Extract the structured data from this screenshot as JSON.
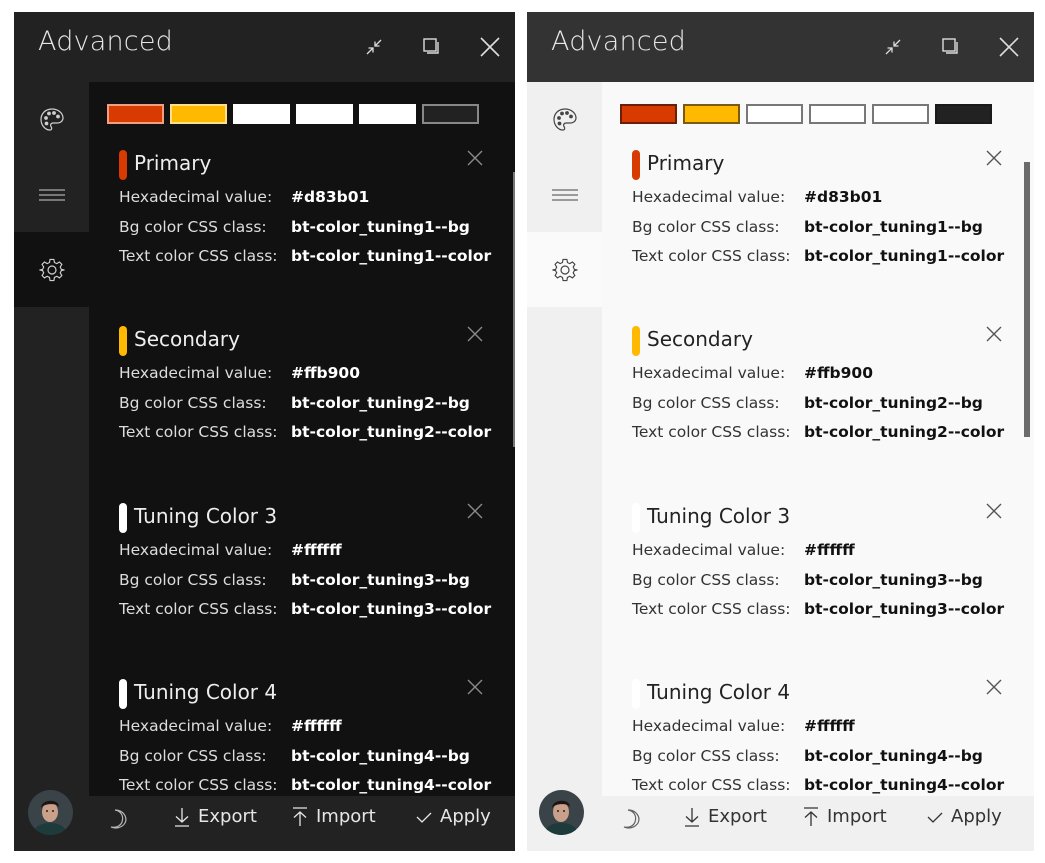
{
  "panels": [
    {
      "theme": "dark",
      "title": "Advanced",
      "window_buttons": {
        "minimize_icon": "collapse-icon",
        "maximize_icon": "restore-icon",
        "close_icon": "close-icon"
      },
      "sidebar": {
        "items": [
          {
            "icon": "palette-icon",
            "active": false
          },
          {
            "icon": "menu-icon",
            "active": false
          },
          {
            "icon": "gear-icon",
            "active": true
          }
        ]
      },
      "swatches": [
        {
          "fill": "#d83b01",
          "border": "#f0a080"
        },
        {
          "fill": "#ffb900",
          "border": "#ffe08a"
        },
        {
          "fill": "#ffffff",
          "border": "#ffffff"
        },
        {
          "fill": "#ffffff",
          "border": "#ffffff"
        },
        {
          "fill": "#ffffff",
          "border": "#ffffff"
        },
        {
          "fill": "#222222",
          "border": "#888888"
        }
      ],
      "colors": [
        {
          "name": "Primary",
          "accent": "#d83b01",
          "hex_label": "Hexadecimal value:",
          "hex": "#d83b01",
          "bg_label": "Bg color CSS class:",
          "bg_class": "bt-color_tuning1--bg",
          "text_label": "Text color CSS class:",
          "text_class": "bt-color_tuning1--color"
        },
        {
          "name": "Secondary",
          "accent": "#ffb900",
          "hex_label": "Hexadecimal value:",
          "hex": "#ffb900",
          "bg_label": "Bg color CSS class:",
          "bg_class": "bt-color_tuning2--bg",
          "text_label": "Text color CSS class:",
          "text_class": "bt-color_tuning2--color"
        },
        {
          "name": "Tuning Color 3",
          "accent": "#ffffff",
          "hex_label": "Hexadecimal value:",
          "hex": "#ffffff",
          "bg_label": "Bg color CSS class:",
          "bg_class": "bt-color_tuning3--bg",
          "text_label": "Text color CSS class:",
          "text_class": "bt-color_tuning3--color"
        },
        {
          "name": "Tuning Color 4",
          "accent": "#ffffff",
          "hex_label": "Hexadecimal value:",
          "hex": "#ffffff",
          "bg_label": "Bg color CSS class:",
          "bg_class": "bt-color_tuning4--bg",
          "text_label": "Text color CSS class:",
          "text_class": "bt-color_tuning4--color"
        }
      ],
      "footer": {
        "theme_toggle_icon": "moon-icon",
        "export_label": "Export",
        "import_label": "Import",
        "apply_label": "Apply"
      }
    },
    {
      "theme": "light",
      "title": "Advanced",
      "window_buttons": {
        "minimize_icon": "collapse-icon",
        "maximize_icon": "restore-icon",
        "close_icon": "close-icon"
      },
      "sidebar": {
        "items": [
          {
            "icon": "palette-icon",
            "active": false
          },
          {
            "icon": "menu-icon",
            "active": false
          },
          {
            "icon": "gear-icon",
            "active": true
          }
        ]
      },
      "swatches": [
        {
          "fill": "#d83b01",
          "border": "#6a2008"
        },
        {
          "fill": "#ffb900",
          "border": "#7a5a10"
        },
        {
          "fill": "#ffffff",
          "border": "#777777"
        },
        {
          "fill": "#ffffff",
          "border": "#777777"
        },
        {
          "fill": "#ffffff",
          "border": "#777777"
        },
        {
          "fill": "#222222",
          "border": "#1a1a1a"
        }
      ],
      "colors": [
        {
          "name": "Primary",
          "accent": "#d83b01",
          "hex_label": "Hexadecimal value:",
          "hex": "#d83b01",
          "bg_label": "Bg color CSS class:",
          "bg_class": "bt-color_tuning1--bg",
          "text_label": "Text color CSS class:",
          "text_class": "bt-color_tuning1--color"
        },
        {
          "name": "Secondary",
          "accent": "#ffb900",
          "hex_label": "Hexadecimal value:",
          "hex": "#ffb900",
          "bg_label": "Bg color CSS class:",
          "bg_class": "bt-color_tuning2--bg",
          "text_label": "Text color CSS class:",
          "text_class": "bt-color_tuning2--color"
        },
        {
          "name": "Tuning Color 3",
          "accent": "#ffffff",
          "hex_label": "Hexadecimal value:",
          "hex": "#ffffff",
          "bg_label": "Bg color CSS class:",
          "bg_class": "bt-color_tuning3--bg",
          "text_label": "Text color CSS class:",
          "text_class": "bt-color_tuning3--color"
        },
        {
          "name": "Tuning Color 4",
          "accent": "#ffffff",
          "hex_label": "Hexadecimal value:",
          "hex": "#ffffff",
          "bg_label": "Bg color CSS class:",
          "bg_class": "bt-color_tuning4--bg",
          "text_label": "Text color CSS class:",
          "text_class": "bt-color_tuning4--color"
        }
      ],
      "footer": {
        "theme_toggle_icon": "moon-icon",
        "export_label": "Export",
        "import_label": "Import",
        "apply_label": "Apply"
      }
    }
  ]
}
